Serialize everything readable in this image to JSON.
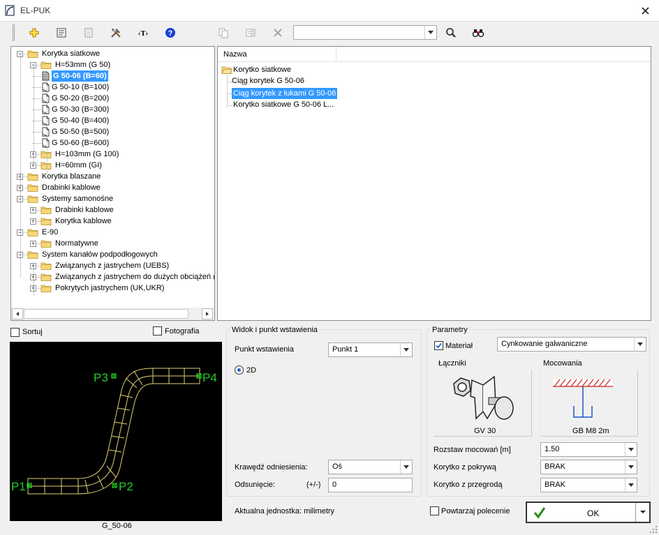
{
  "window": {
    "title": "EL-PUK"
  },
  "toolbar": {
    "search_value": ""
  },
  "tree": {
    "items": [
      {
        "label": "Korytka siatkowe",
        "selected": false
      },
      {
        "label": "H=53mm (G 50)",
        "selected": false
      },
      {
        "label": "G 50-06 (B=60)",
        "selected": true
      },
      {
        "label": "G 50-10 (B=100)",
        "selected": false
      },
      {
        "label": "G 50-20 (B=200)",
        "selected": false
      },
      {
        "label": "G 50-30 (B=300)",
        "selected": false
      },
      {
        "label": "G 50-40 (B=400)",
        "selected": false
      },
      {
        "label": "G 50-50 (B=500)",
        "selected": false
      },
      {
        "label": "G 50-60 (B=600)",
        "selected": false
      },
      {
        "label": "H=103mm (G 100)",
        "selected": false
      },
      {
        "label": "H=60mm (GI)",
        "selected": false
      },
      {
        "label": "Korytka blaszane",
        "selected": false
      },
      {
        "label": "Drabinki kablowe",
        "selected": false
      },
      {
        "label": "Systemy samonośne",
        "selected": false
      },
      {
        "label": "Drabinki kablowe",
        "selected": false
      },
      {
        "label": "Korytka kablowe",
        "selected": false
      },
      {
        "label": "E-90",
        "selected": false
      },
      {
        "label": "Normatywne",
        "selected": false
      },
      {
        "label": "System kanałów podpodłogowych",
        "selected": false
      },
      {
        "label": "Związanych z jastrychem (UEBS)",
        "selected": false
      },
      {
        "label": "Związanych z jastrychem do dużych obciążeń (U",
        "selected": false
      },
      {
        "label": "Pokrytych jastrychem (UK,UKR)",
        "selected": false
      }
    ]
  },
  "list": {
    "header": "Nazwa",
    "items": [
      {
        "label": "Korytko siatkowe"
      },
      {
        "label": "Ciąg korytek G 50-06"
      },
      {
        "label": "Ciąg korytek z łukami G 50-06"
      },
      {
        "label": "Korytko siatkowe G 50-06 L..."
      }
    ]
  },
  "preview": {
    "sort_label": "Sortuj",
    "photo_label": "Fotografia",
    "caption": "G_50-06",
    "points": [
      "P1",
      "P2",
      "P3",
      "P4"
    ]
  },
  "insert": {
    "group_title": "Widok i punkt wstawienia",
    "point_label": "Punkt wstawienia",
    "point_value": "Punkt 1",
    "mode_2d": "2D",
    "edge_label": "Krawędź odniesienia:",
    "edge_value": "Oś",
    "offset_label": "Odsunięcie:",
    "offset_sign": "(+/-)",
    "offset_value": "0",
    "unit_text": "Aktualna jednostka: milimetry"
  },
  "params": {
    "group_title": "Parametry",
    "material_label": "Materiał",
    "material_value": "Cynkowanie galwaniczne",
    "connectors_label": "Łączniki",
    "connector_caption": "GV 30",
    "mounting_label": "Mocowania",
    "mounting_caption": "GB M8 2m",
    "spacing_label": "Rozstaw mocowań [m]",
    "spacing_value": "1.50",
    "cover_label": "Korytko z pokrywą",
    "cover_value": "BRAK",
    "divider_label": "Korytko z przegrodą",
    "divider_value": "BRAK"
  },
  "footer": {
    "repeat_label": "Powtarzaj polecenie",
    "ok_label": "OK"
  },
  "colors": {
    "accent": "#3399ff",
    "cad_line": "#e0d070",
    "cad_point": "#22cc22"
  }
}
